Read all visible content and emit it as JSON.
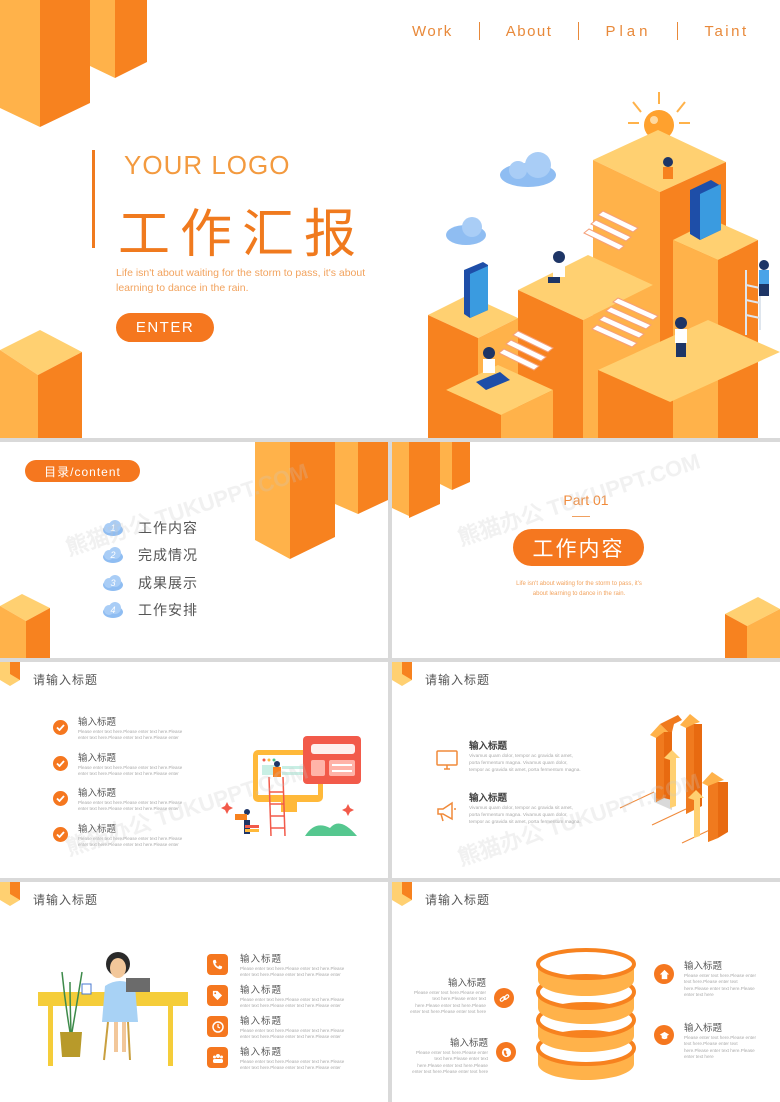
{
  "colors": {
    "accent": "#f5771f",
    "accent_light": "#ffb24a",
    "text_dark": "#555555",
    "text_muted": "#aaaaaa",
    "cloud_blue": "#8fbdf2"
  },
  "watermark": "熊猫办公 TUKUPPT.COM",
  "cover": {
    "nav": [
      "Work",
      "About",
      "Plan",
      "Taint"
    ],
    "logo": "YOUR LOGO",
    "title": "工作汇报",
    "quote": "Life isn't about waiting for the storm to pass, it's about learning to dance in the rain.",
    "enter_label": "ENTER"
  },
  "toc": {
    "pill": "目录/content",
    "items": [
      {
        "num": "1",
        "label": "工作内容"
      },
      {
        "num": "2",
        "label": "完成情况"
      },
      {
        "num": "3",
        "label": "成果展示"
      },
      {
        "num": "4",
        "label": "工作安排"
      }
    ]
  },
  "part": {
    "part_label": "Part 01",
    "title": "工作内容",
    "quote": "Life isn't about waiting for the storm to pass, it's about learning to dance in the rain."
  },
  "slide_checks": {
    "title": "请输入标题",
    "items": [
      {
        "heading": "输入标题",
        "body": "Please enter text here.Please enter text here.Please enter text here.Please enter text here.Please enter"
      },
      {
        "heading": "输入标题",
        "body": "Please enter text here.Please enter text here.Please enter text here.Please enter text here.Please enter"
      },
      {
        "heading": "输入标题",
        "body": "Please enter text here.Please enter text here.Please enter text here.Please enter text here.Please enter"
      },
      {
        "heading": "输入标题",
        "body": "Please enter text here.Please enter text here.Please enter text here.Please enter text here.Please enter"
      }
    ]
  },
  "slide_arrows": {
    "title": "请输入标题",
    "items": [
      {
        "icon": "monitor-icon",
        "heading": "输入标题",
        "body": "Vivamus quam dolor, tempor ac gravida sit amet, porta fermentum magna. Vivamus quam dolor, tempor ac gravida sit amet, porta fermentum magna."
      },
      {
        "icon": "megaphone-icon",
        "heading": "输入标题",
        "body": "Vivamus quam dolor, tempor ac gravida sit amet, porta fermentum magna. Vivamus quam dolor, tempor ac gravida sit amet, porta fermentum magna."
      }
    ]
  },
  "slide_desk": {
    "title": "请输入标题",
    "items": [
      {
        "icon": "phone-icon",
        "heading": "输入标题",
        "body": "Please enter text here.Please enter text here.Please enter text here.Please enter text here.Please enter"
      },
      {
        "icon": "tag-icon",
        "heading": "输入标题",
        "body": "Please enter text here.Please enter text here.Please enter text here.Please enter text here.Please enter"
      },
      {
        "icon": "clock-icon",
        "heading": "输入标题",
        "body": "Please enter text here.Please enter text here.Please enter text here.Please enter text here.Please enter"
      },
      {
        "icon": "team-icon",
        "heading": "输入标题",
        "body": "Please enter text here.Please enter text here.Please enter text here.Please enter text here.Please enter"
      }
    ]
  },
  "slide_rings": {
    "title": "请输入标题",
    "left_items": [
      {
        "icon": "link-icon",
        "heading": "输入标题",
        "body": "Please enter text here.Please enter text here.Please enter text here.Please enter text here.Please enter text here.Please enter text here"
      },
      {
        "icon": "globe-icon",
        "heading": "输入标题",
        "body": "Please enter text here.Please enter text here.Please enter text here.Please enter text here.Please enter text here.Please enter text here"
      }
    ],
    "right_items": [
      {
        "icon": "home-icon",
        "heading": "输入标题",
        "body": "Please enter text here.Please enter text here.Please enter text here.Please enter text here.Please enter text here"
      },
      {
        "icon": "graduation-cap-icon",
        "heading": "输入标题",
        "body": "Please enter text here.Please enter text here.Please enter text here.Please enter text here.Please enter text here"
      }
    ]
  }
}
